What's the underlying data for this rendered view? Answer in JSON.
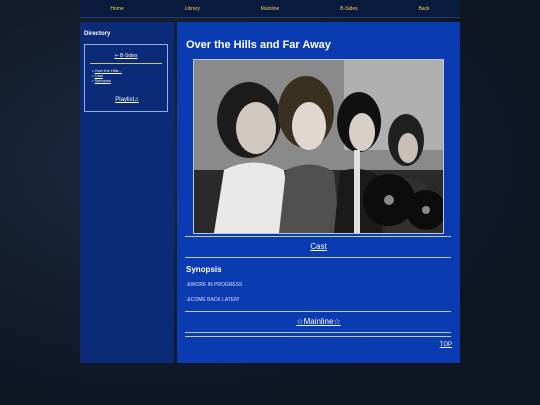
{
  "nav": {
    "items": [
      {
        "label": "Home"
      },
      {
        "label": "Library"
      },
      {
        "label": "Mainline"
      },
      {
        "label": "B-Sides"
      },
      {
        "label": "Back"
      }
    ]
  },
  "sidebar": {
    "title": "Directory",
    "bsides_link": "⇐ B-Sides",
    "links": [
      {
        "label": "Over the Hills..."
      },
      {
        "label": "Cast"
      },
      {
        "label": "Synopsis"
      }
    ],
    "playlist": "Playlist♫"
  },
  "main": {
    "title": "Over the Hills and Far Away",
    "cast_link": "Cast",
    "synopsis_title": "Synopsis",
    "synopsis_lines": [
      ":&WORK IN PROGRESS",
      ":&COME BACK LATER!"
    ],
    "mainline_link": "☆Mainline☆",
    "top_link": "TOP"
  },
  "colors": {
    "nav_text": "#f0d060",
    "sidebar_bg": "#0b2a78",
    "main_bg": "#0b3bb0",
    "rule": "#b8d0a0"
  }
}
